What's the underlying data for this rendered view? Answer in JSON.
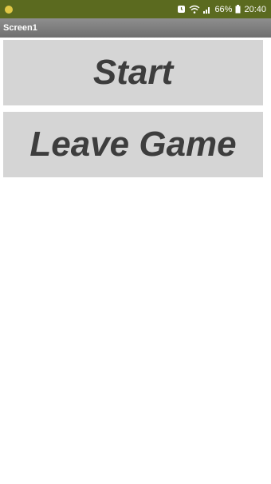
{
  "status_bar": {
    "battery": "66%",
    "time": "20:40",
    "icons": [
      "notification-icon",
      "alarm-icon",
      "wifi-icon",
      "signal-icon",
      "battery-icon"
    ]
  },
  "app_bar": {
    "title": "Screen1"
  },
  "buttons": {
    "start_label": "Start",
    "leave_label": "Leave Game"
  },
  "colors": {
    "status_bar": "#5b6a1f",
    "app_bar": "#7e7e7e",
    "button_bg": "#d5d5d5",
    "button_text": "#3d3d3d"
  }
}
